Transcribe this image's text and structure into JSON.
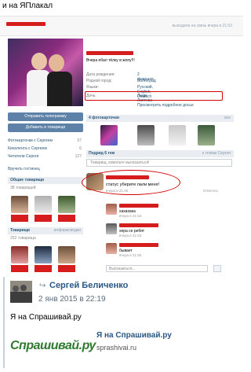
{
  "post_caption": "и на ЯПлакал",
  "screenshot": {
    "top_bar": {
      "last_seen": "выходила на связь вчера в 21:53"
    },
    "profile": {
      "status": "Вчера ебал тёлку в жопу!!!",
      "info": [
        {
          "key": "Дата рождения:",
          "value": "2 февраля"
        },
        {
          "key": "Родной город:",
          "value": "Волгоград"
        },
        {
          "key": "Языки:",
          "value": "Русский, English, Deutsch"
        },
        {
          "key": "Дочь:",
          "value": "Люда Лаптева"
        }
      ],
      "more_info": "Просмотреть подробное досье"
    },
    "left_column": {
      "send_gift": "Отправить телеграмму",
      "add_friend": "Добавить в товарищи",
      "rows": [
        {
          "label": "Фотокарточки с Сергеем",
          "count": "57"
        },
        {
          "label": "Кинолента с Сергеем",
          "count": "6"
        },
        {
          "label": "Читатели Сергея",
          "count": "127"
        },
        {
          "label": "Вручить гостинец",
          "count": ""
        }
      ],
      "friends_header": "Общие товарищи",
      "friends_count": "38 товарищей",
      "friends_header2": "Товарищи",
      "friends_header2_right": "информсводки",
      "friends_count2": "252 товарища"
    },
    "photos_section": {
      "title": "4 фотокарточки",
      "right": "все"
    },
    "wall_section": {
      "title": "Подряд 6 тем",
      "right": "к темам Сергея",
      "input_placeholder": "Товарищ, извольте высказаться!"
    },
    "post": {
      "text": "статус уберите пали меня!",
      "meta": "вчера в 21:45",
      "reply": "Ответить"
    },
    "comments": [
      {
        "text": "хахахака",
        "date": "вчера в 21:53"
      },
      {
        "text": "хера се ребят",
        "date": "вчера в 21:53"
      },
      {
        "text": "бывает",
        "date": "вчера в 21:55"
      }
    ],
    "answer_placeholder": "Высказаться..."
  },
  "repost": {
    "author": "Сергей Беличенко",
    "date": "2 янв 2015 в 22:19",
    "text": "Я на Спрашивай.ру",
    "link_title": "Я на Спрашивай.ру",
    "link_url": "sprashivai.ru",
    "logo_text": "Спрашивай.ру"
  },
  "colors": {
    "vk_blue": "#2b587a",
    "censor_red": "#d61d1d",
    "link_blue": "#2a5885",
    "logo_green": "#2f7a2f"
  }
}
